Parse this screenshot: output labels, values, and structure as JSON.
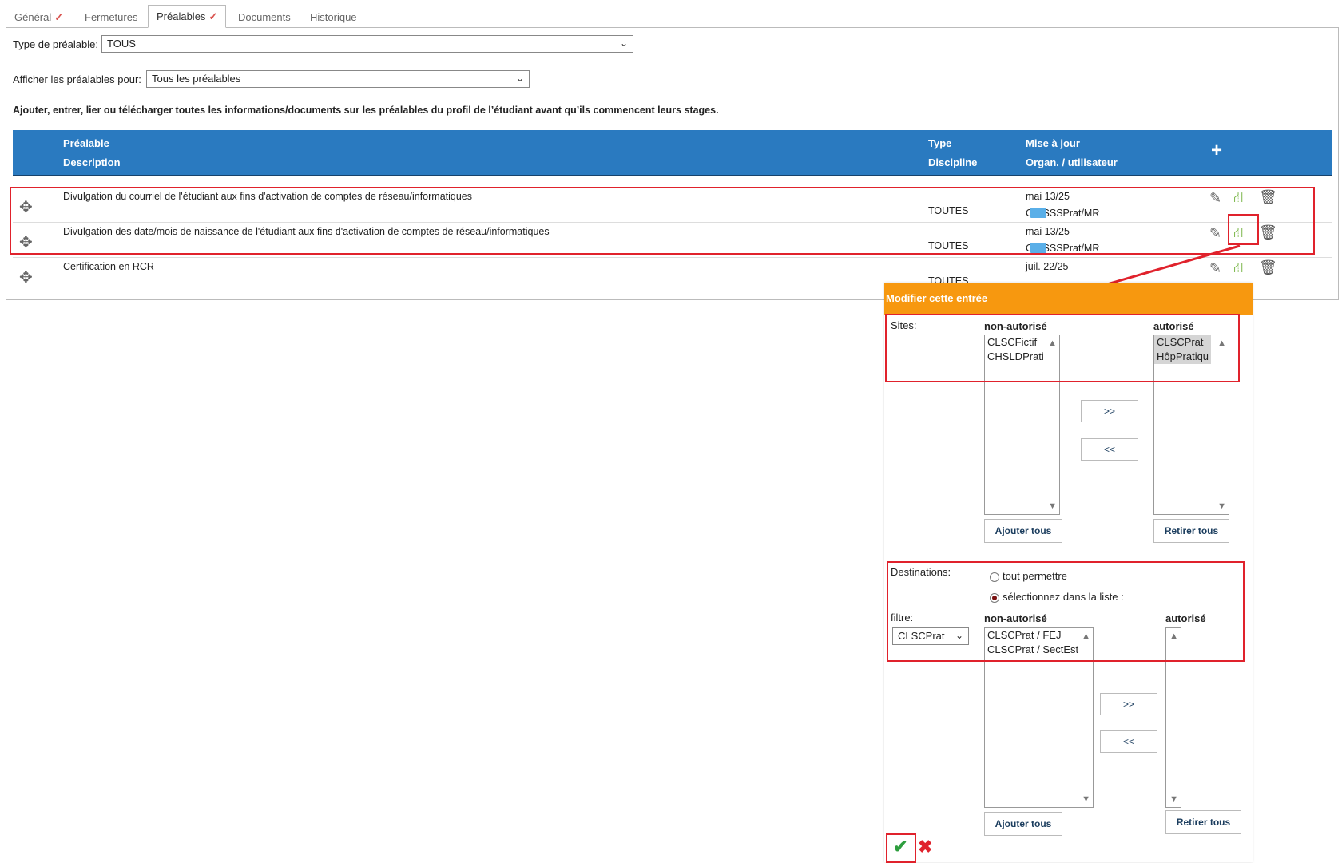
{
  "tabs": [
    {
      "label": "Général",
      "checked": true
    },
    {
      "label": "Fermetures",
      "checked": false
    },
    {
      "label": "Préalables",
      "checked": true,
      "active": true
    },
    {
      "label": "Documents",
      "checked": false
    },
    {
      "label": "Historique",
      "checked": false
    }
  ],
  "filters": {
    "type_label": "Type de préalable:",
    "type_value": "TOUS",
    "show_label": "Afficher les préalables pour:",
    "show_value": "Tous les préalables"
  },
  "intro": "Ajouter, entrer, lier ou télécharger toutes les informations/documents sur les préalables du profil de l’étudiant avant qu’ils commencent leurs stages.",
  "table": {
    "headers": {
      "prealable": "Préalable",
      "description": "Description",
      "type": "Type",
      "discipline": "Discipline",
      "update": "Mise à jour",
      "org": "Organ. / utilisateur",
      "add": "+"
    },
    "rows": [
      {
        "title": "Divulgation du courriel de l'étudiant aux fins d'activation de comptes de réseau/informatiques",
        "discipline": "TOUTES",
        "date": "mai 13/25",
        "org": "CIUSSSPrat/MR"
      },
      {
        "title": "Divulgation des date/mois de naissance de l'étudiant aux fins d'activation de comptes de réseau/informatiques",
        "discipline": "TOUTES",
        "date": "mai 13/25",
        "org": "CIUSSSPrat/MR"
      },
      {
        "title": "Certification en RCR",
        "discipline": "TOUTES",
        "date": "juil. 22/25",
        "org": ""
      }
    ]
  },
  "modal": {
    "title": "Modifier cette entrée",
    "sites": {
      "label": "Sites:",
      "non_label": "non-autorisé",
      "auth_label": "autorisé",
      "non_items": [
        "CLSCFictif",
        "CHSLDPrati"
      ],
      "auth_items": [
        "CLSCPrat",
        "HôpPratiqu"
      ],
      "move_right": ">>",
      "move_left": "<<",
      "add_all": "Ajouter tous",
      "remove_all": "Retirer tous"
    },
    "destinations": {
      "label": "Destinations:",
      "radio_all": "tout permettre",
      "radio_select": "sélectionnez dans la liste :",
      "filter_label": "filtre:",
      "filter_value": "CLSCPrat",
      "non_label": "non-autorisé",
      "auth_label": "autorisé",
      "non_items": [
        "CLSCPrat / FEJ",
        "CLSCPrat / SectEst"
      ],
      "move_right": ">>",
      "move_left": "<<",
      "add_all": "Ajouter tous",
      "remove_all": "Retirer tous"
    },
    "icons": {
      "confirm": "checkmark-icon",
      "cancel": "close-icon"
    }
  },
  "colors": {
    "header_blue": "#2a7ac0",
    "modal_orange": "#f7980f",
    "highlight_red": "#e0222c"
  }
}
